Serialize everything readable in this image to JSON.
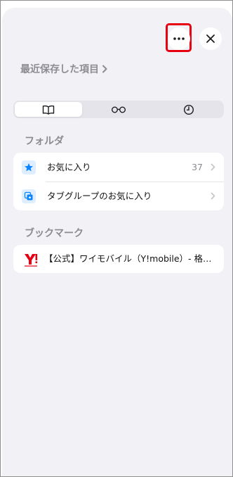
{
  "header": {
    "more_icon": "ellipsis-icon",
    "close_icon": "close-icon",
    "highlight_color": "#e60012"
  },
  "recent": {
    "label": "最近保存した項目",
    "chevron_icon": "chevron-right-icon"
  },
  "tabs": [
    {
      "icon": "book-icon",
      "active": true
    },
    {
      "icon": "glasses-icon",
      "active": false
    },
    {
      "icon": "clock-icon",
      "active": false
    }
  ],
  "folders": {
    "title": "フォルダ",
    "items": [
      {
        "label": "お気に入り",
        "count": "37",
        "icon": "star-icon"
      },
      {
        "label": "タブグループのお気に入り",
        "icon": "tab-group-icon"
      }
    ]
  },
  "bookmarks": {
    "title": "ブックマーク",
    "items": [
      {
        "label": "【公式】ワイモバイル（Y!mobile）- 格安SIMならワイモバイル",
        "icon": "ymobile-logo"
      }
    ]
  },
  "colors": {
    "accent": "#0a84ff",
    "sheet_bg": "#f2f1f6",
    "ymobile_red": "#e60012"
  }
}
